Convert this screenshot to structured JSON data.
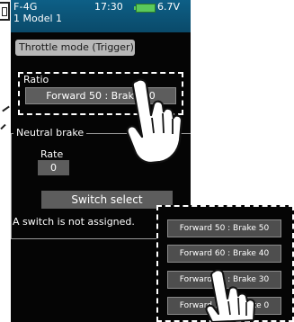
{
  "status_bar": {
    "model_type": "F-4G",
    "model_name": "1   Model 1",
    "time": "17:30",
    "voltage": "6.7V",
    "battery_icon": "battery-icon"
  },
  "title": "Throttle mode (Trigger)",
  "ratio": {
    "label": "Ratio",
    "value": "Forward 50 : Brake 50"
  },
  "neutral_brake": {
    "label": "Neutral brake",
    "rate_label": "Rate",
    "rate_value": "0",
    "switch_select_label": "Switch select",
    "switch_status": "A switch is not assigned."
  },
  "popup": {
    "options": [
      "Forward 50 : Brake 50",
      "Forward 60 : Brake 40",
      "Forward 70 : Brake 30",
      "Forward 100 : Brake 0"
    ]
  },
  "colors": {
    "status_bar": "#0d5f86",
    "screen_bg": "#050505",
    "button_bg": "#5d5d5d",
    "battery": "#5bc95b"
  }
}
